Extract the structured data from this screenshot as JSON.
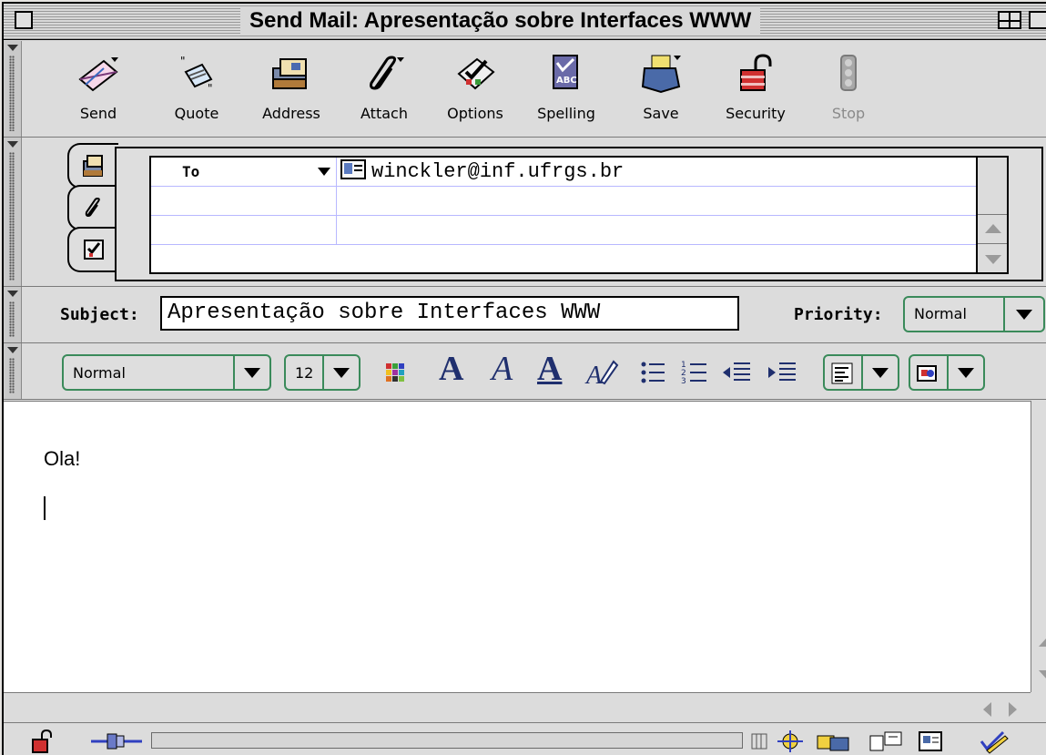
{
  "window": {
    "title": "Send Mail: Apresentação sobre Interfaces WWW"
  },
  "toolbar": {
    "buttons": [
      {
        "label": "Send",
        "icon": "send-icon",
        "enabled": true
      },
      {
        "label": "Quote",
        "icon": "quote-icon",
        "enabled": true
      },
      {
        "label": "Address",
        "icon": "address-book-icon",
        "enabled": true
      },
      {
        "label": "Attach",
        "icon": "paperclip-icon",
        "enabled": true
      },
      {
        "label": "Options",
        "icon": "options-checklist-icon",
        "enabled": true
      },
      {
        "label": "Spelling",
        "icon": "spelling-icon",
        "enabled": true
      },
      {
        "label": "Save",
        "icon": "save-icon",
        "enabled": true
      },
      {
        "label": "Security",
        "icon": "lock-icon",
        "enabled": true
      },
      {
        "label": "Stop",
        "icon": "stop-traffic-light-icon",
        "enabled": false
      }
    ]
  },
  "address": {
    "rows": [
      {
        "type": "To",
        "value": "winckler@inf.ufrgs.br"
      },
      {
        "type": "",
        "value": ""
      },
      {
        "type": "",
        "value": ""
      }
    ]
  },
  "subject": {
    "label": "Subject:",
    "value": "Apresentação sobre Interfaces WWW"
  },
  "priority": {
    "label": "Priority:",
    "value": "Normal"
  },
  "format": {
    "paragraph_style": "Normal",
    "font_size": "12"
  },
  "body": {
    "text": "Ola!"
  },
  "colors": {
    "select_border": "#3a8a5a",
    "format_letter": "#1f2f6e",
    "address_rule": "#b8b8ff"
  }
}
